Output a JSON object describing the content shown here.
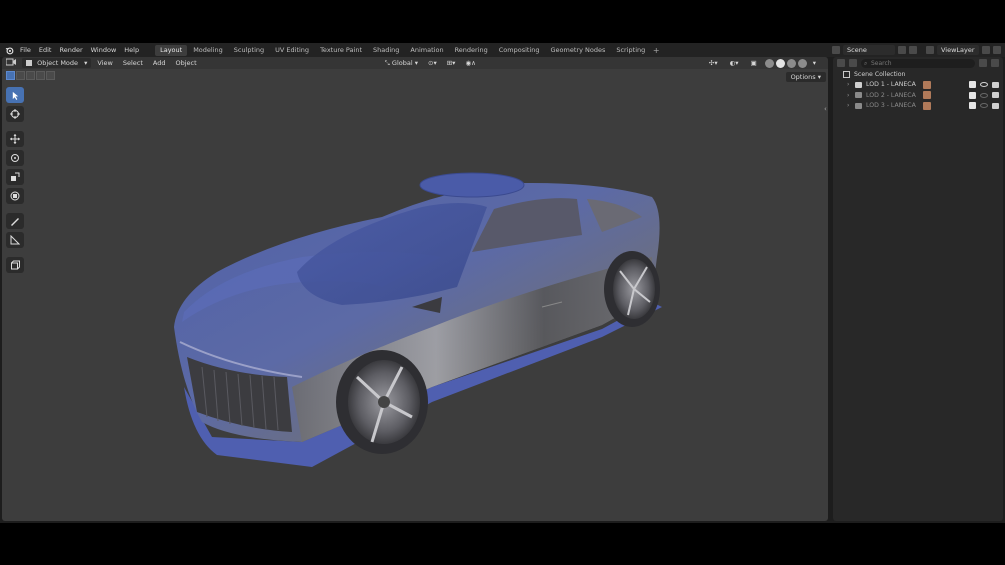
{
  "menu": {
    "items": [
      "File",
      "Edit",
      "Render",
      "Window",
      "Help"
    ]
  },
  "workspaces": {
    "tabs": [
      "Layout",
      "Modeling",
      "Sculpting",
      "UV Editing",
      "Texture Paint",
      "Shading",
      "Animation",
      "Rendering",
      "Compositing",
      "Geometry Nodes",
      "Scripting"
    ],
    "active": "Layout",
    "add": "+"
  },
  "scene": {
    "name": "Scene",
    "view_layer": "ViewLayer"
  },
  "viewport": {
    "mode": "Object Mode",
    "menus": [
      "View",
      "Select",
      "Add",
      "Object"
    ],
    "orientation": "Global",
    "options_label": "Options"
  },
  "toolbar": {
    "tools": [
      "select-box-icon",
      "cursor-icon",
      "move-icon",
      "rotate-icon",
      "scale-icon",
      "transform-icon",
      "annotate-icon",
      "measure-icon",
      "add-cube-icon"
    ]
  },
  "outliner": {
    "search_placeholder": "Search",
    "collection": "Scene Collection",
    "items": [
      {
        "name": "LOD 1 - LANECA",
        "visible": true
      },
      {
        "name": "LOD 2 - LANECA",
        "visible": false
      },
      {
        "name": "LOD 3 - LANECA",
        "visible": false
      }
    ]
  },
  "colors": {
    "accent": "#4772b3",
    "viewport_bg": "#3d3d3d",
    "panel_bg": "#282828"
  }
}
